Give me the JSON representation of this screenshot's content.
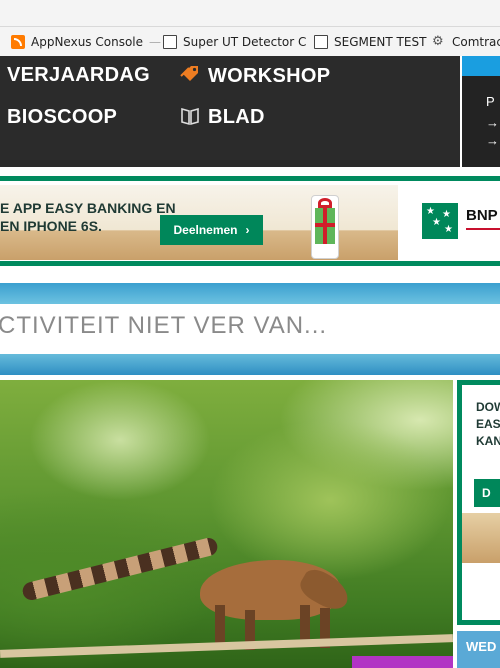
{
  "bookmarks": [
    {
      "label": "AppNexus Console",
      "icon": "rss-icon",
      "trail": "—"
    },
    {
      "label": "Super UT Detector C",
      "icon": "document-icon"
    },
    {
      "label": "SEGMENT TEST",
      "icon": "document-icon"
    },
    {
      "label": "Comtrac",
      "icon": "gear-icon"
    }
  ],
  "nav": {
    "items": [
      {
        "label": "VERJAARDAG"
      },
      {
        "label": "WORKSHOP",
        "icon": "tag-icon"
      },
      {
        "label": "BIOSCOOP"
      },
      {
        "label": "BLAD",
        "icon": "book-icon"
      }
    ],
    "side": {
      "line1": "P",
      "arrow1": "→",
      "arrow2": "→"
    }
  },
  "banner_ad": {
    "text": "E APP EASY BANKING EN\nEN IPHONE 6S.",
    "button": "Deelnemen",
    "button_arrow": "›",
    "brand": "BNP"
  },
  "section": {
    "title": "CTIVITEIT NIET VER VAN..."
  },
  "side_ad": {
    "lines": [
      "DOW",
      "EASY",
      "KANS"
    ],
    "button": "D"
  },
  "weather": {
    "label": "WED"
  },
  "colors": {
    "nav_bg": "#2b2b2b",
    "accent_orange": "#ee7d22",
    "bnp_green": "#008a5e",
    "band_blue": "#3b9fcf",
    "tag_purple": "#b234c4"
  }
}
